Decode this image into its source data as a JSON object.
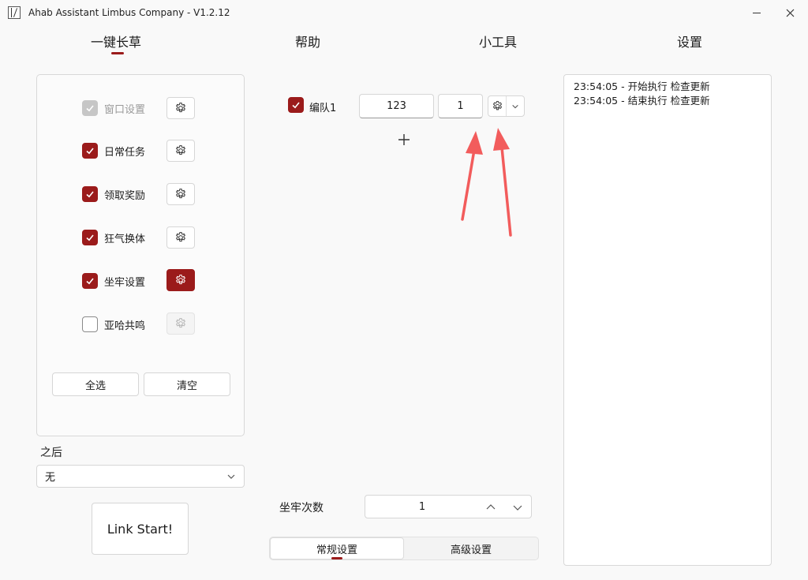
{
  "window": {
    "title": "Ahab Assistant Limbus Company -  V1.2.12",
    "minimize_icon": "minimize-icon",
    "close_icon": "close-icon"
  },
  "nav": {
    "tabs": [
      {
        "label": "一键长草",
        "active": true
      },
      {
        "label": "帮助",
        "active": false
      },
      {
        "label": "小工具",
        "active": false
      },
      {
        "label": "设置",
        "active": false
      }
    ]
  },
  "tasks": {
    "items": [
      {
        "label": "窗口设置",
        "checked": true,
        "disabled": true,
        "gear_state": "normal"
      },
      {
        "label": "日常任务",
        "checked": true,
        "disabled": false,
        "gear_state": "normal"
      },
      {
        "label": "领取奖励",
        "checked": true,
        "disabled": false,
        "gear_state": "normal"
      },
      {
        "label": "狂气换体",
        "checked": true,
        "disabled": false,
        "gear_state": "normal"
      },
      {
        "label": "坐牢设置",
        "checked": true,
        "disabled": false,
        "gear_state": "active"
      },
      {
        "label": "亚哈共鸣",
        "checked": false,
        "disabled": false,
        "gear_state": "disabled"
      }
    ],
    "select_all_label": "全选",
    "clear_label": "清空"
  },
  "after": {
    "label": "之后",
    "selected": "无"
  },
  "start_button_label": "Link Start!",
  "team": {
    "checked": true,
    "label": "编队1",
    "value_a": "123",
    "value_b": "1"
  },
  "prison": {
    "count_label": "坐牢次数",
    "count_value": "1"
  },
  "bottom_tabs": [
    {
      "label": "常规设置",
      "active": true
    },
    {
      "label": "高级设置",
      "active": false
    }
  ],
  "log": {
    "lines": [
      "23:54:05 - 开始执行 检查更新",
      "23:54:05 - 结束执行 检查更新"
    ]
  },
  "colors": {
    "accent": "#9b1b1b",
    "annotation_arrow": "#f25c5c"
  }
}
